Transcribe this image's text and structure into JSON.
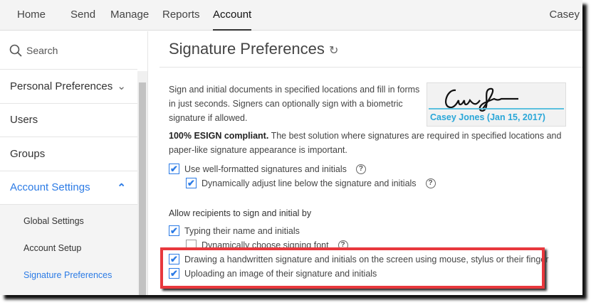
{
  "nav": {
    "items": [
      "Home",
      "Send",
      "Manage",
      "Reports",
      "Account"
    ],
    "active": "Account",
    "user": "Casey"
  },
  "sidebar": {
    "search_placeholder": "Search",
    "items": [
      "Personal Preferences",
      "Users",
      "Groups",
      "Account Settings"
    ],
    "sub_items": [
      "Global Settings",
      "Account Setup",
      "Signature Preferences"
    ]
  },
  "main": {
    "title": "Signature Preferences",
    "intro": "Sign and initial documents in specified locations and fill in forms in just seconds. Signers can optionally sign with a biometric signature if allowed.",
    "esign_bold": "100% ESIGN compliant.",
    "esign_text": " The best solution where signatures are required in specified locations and paper-like signature appearance is important.",
    "signature_caption": "Casey Jones (Jan 15, 2017)",
    "options": [
      {
        "label": "Use well-formatted signatures and initials",
        "checked": true
      },
      {
        "label": "Dynamically adjust line below the signature and initials",
        "checked": true
      }
    ],
    "allow_heading": "Allow recipients to sign and initial by",
    "allow_options": [
      {
        "label": "Typing their name and initials",
        "checked": true
      },
      {
        "label": "Dynamically choose signing font",
        "checked": false
      },
      {
        "label": "Drawing a handwritten signature and initials on the screen using mouse, stylus or their finger",
        "checked": true
      },
      {
        "label": "Uploading an image of their signature and initials",
        "checked": true
      }
    ]
  },
  "colors": {
    "accent": "#2c7be5",
    "highlight": "#e8383d"
  }
}
